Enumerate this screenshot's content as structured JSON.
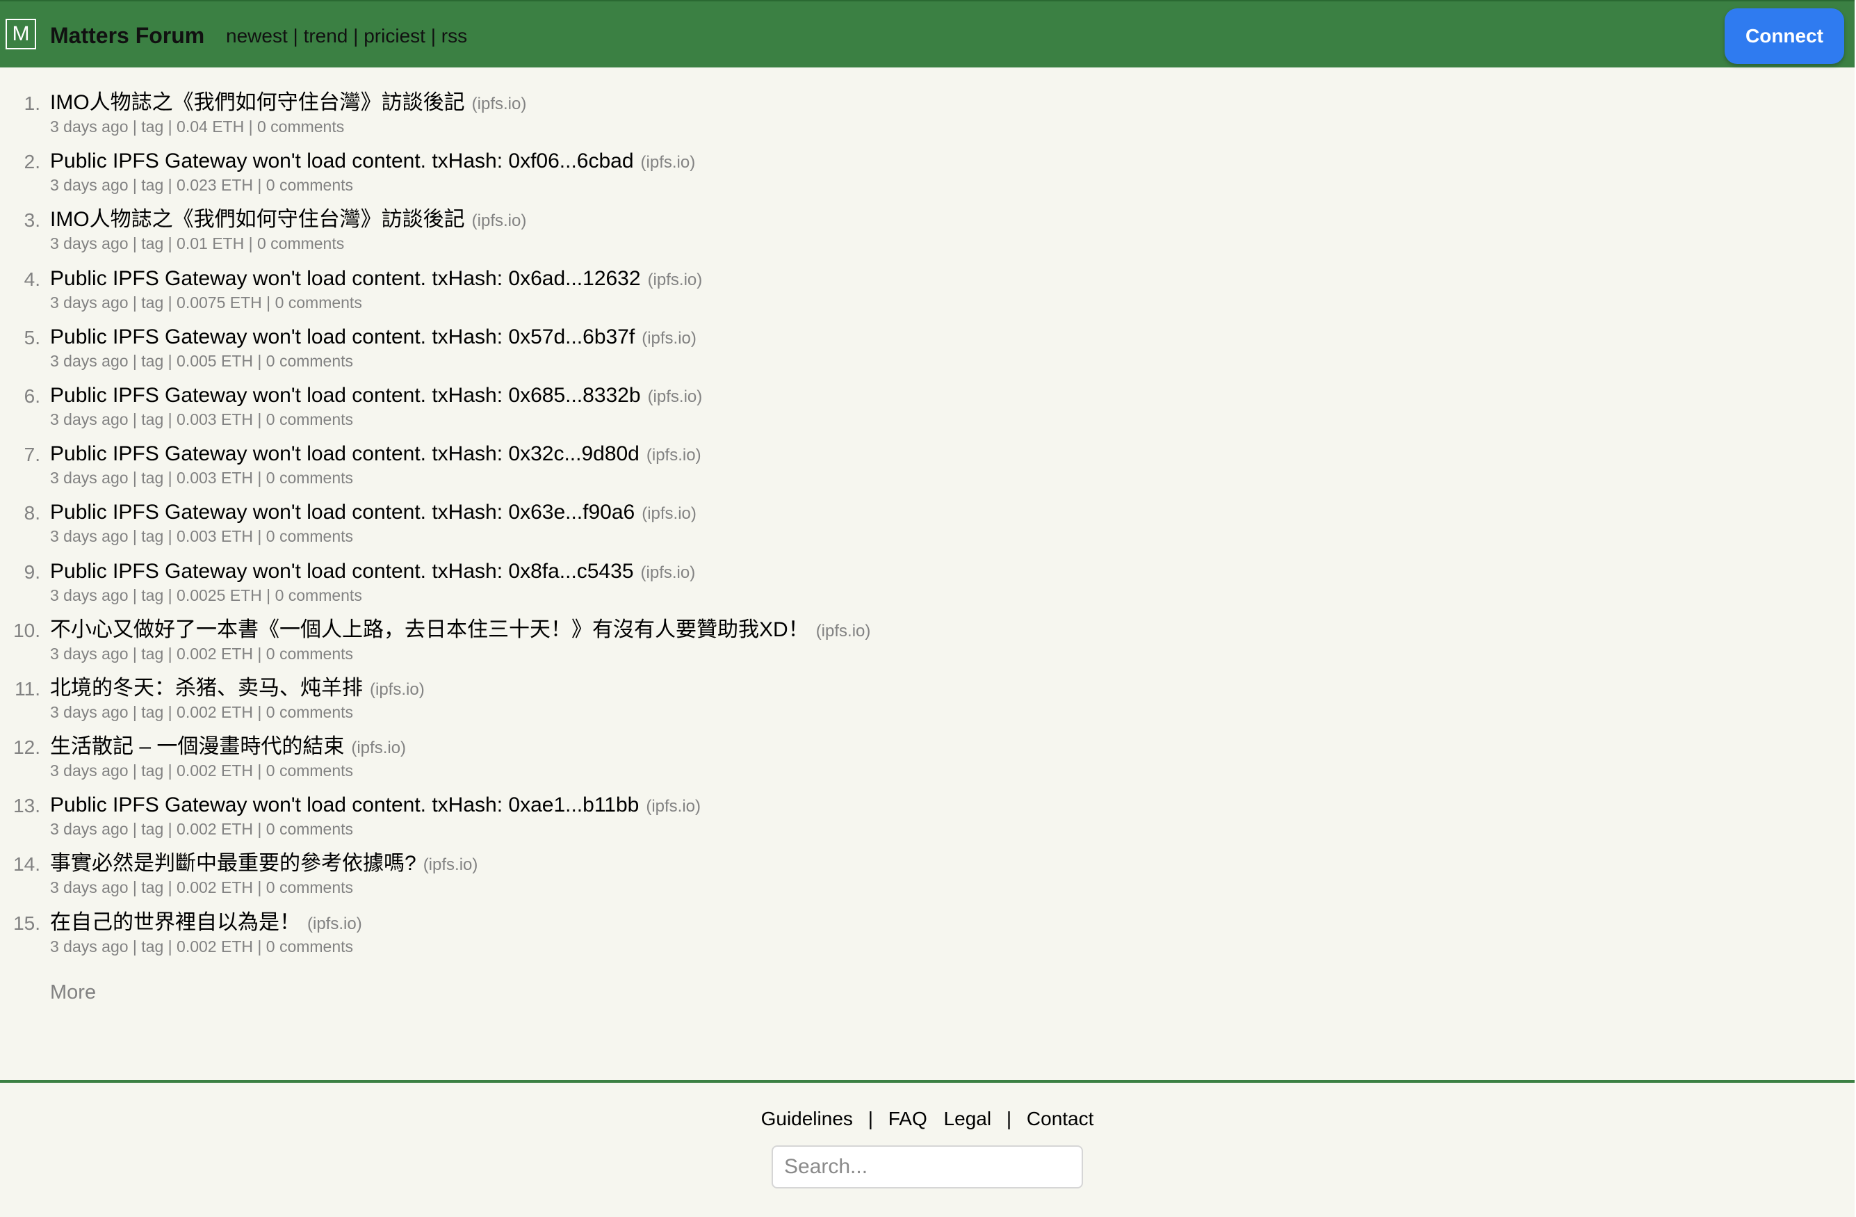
{
  "header": {
    "logo_letter": "M",
    "site_title": "Matters Forum",
    "nav": [
      "newest",
      "trend",
      "priciest",
      "rss"
    ],
    "connect_label": "Connect",
    "accent_color": "#3b8043",
    "button_color": "#2f7bf0"
  },
  "items": [
    {
      "rank": "1.",
      "title": "IMO人物誌之《我們如何守住台灣》訪談後記",
      "site": "(ipfs.io)",
      "age": "3 days ago",
      "tag": "tag",
      "price": "0.04 ETH",
      "comments": "0 comments"
    },
    {
      "rank": "2.",
      "title": "Public IPFS Gateway won't load content. txHash: 0xf06...6cbad",
      "site": "(ipfs.io)",
      "age": "3 days ago",
      "tag": "tag",
      "price": "0.023 ETH",
      "comments": "0 comments"
    },
    {
      "rank": "3.",
      "title": "IMO人物誌之《我們如何守住台灣》訪談後記",
      "site": "(ipfs.io)",
      "age": "3 days ago",
      "tag": "tag",
      "price": "0.01 ETH",
      "comments": "0 comments"
    },
    {
      "rank": "4.",
      "title": "Public IPFS Gateway won't load content. txHash: 0x6ad...12632",
      "site": "(ipfs.io)",
      "age": "3 days ago",
      "tag": "tag",
      "price": "0.0075 ETH",
      "comments": "0 comments"
    },
    {
      "rank": "5.",
      "title": "Public IPFS Gateway won't load content. txHash: 0x57d...6b37f",
      "site": "(ipfs.io)",
      "age": "3 days ago",
      "tag": "tag",
      "price": "0.005 ETH",
      "comments": "0 comments"
    },
    {
      "rank": "6.",
      "title": "Public IPFS Gateway won't load content. txHash: 0x685...8332b",
      "site": "(ipfs.io)",
      "age": "3 days ago",
      "tag": "tag",
      "price": "0.003 ETH",
      "comments": "0 comments"
    },
    {
      "rank": "7.",
      "title": "Public IPFS Gateway won't load content. txHash: 0x32c...9d80d",
      "site": "(ipfs.io)",
      "age": "3 days ago",
      "tag": "tag",
      "price": "0.003 ETH",
      "comments": "0 comments"
    },
    {
      "rank": "8.",
      "title": "Public IPFS Gateway won't load content. txHash: 0x63e...f90a6",
      "site": "(ipfs.io)",
      "age": "3 days ago",
      "tag": "tag",
      "price": "0.003 ETH",
      "comments": "0 comments"
    },
    {
      "rank": "9.",
      "title": "Public IPFS Gateway won't load content. txHash: 0x8fa...c5435",
      "site": "(ipfs.io)",
      "age": "3 days ago",
      "tag": "tag",
      "price": "0.0025 ETH",
      "comments": "0 comments"
    },
    {
      "rank": "10.",
      "title": "不小心又做好了一本書《一個人上路，去日本住三十天！》有沒有人要贊助我XD！",
      "site": "(ipfs.io)",
      "age": "3 days ago",
      "tag": "tag",
      "price": "0.002 ETH",
      "comments": "0 comments"
    },
    {
      "rank": "11.",
      "title": "北境的冬天：杀猪、卖马、炖羊排",
      "site": "(ipfs.io)",
      "age": "3 days ago",
      "tag": "tag",
      "price": "0.002 ETH",
      "comments": "0 comments"
    },
    {
      "rank": "12.",
      "title": "生活散記 – 一個漫畫時代的結束",
      "site": "(ipfs.io)",
      "age": "3 days ago",
      "tag": "tag",
      "price": "0.002 ETH",
      "comments": "0 comments"
    },
    {
      "rank": "13.",
      "title": "Public IPFS Gateway won't load content. txHash: 0xae1...b11bb",
      "site": "(ipfs.io)",
      "age": "3 days ago",
      "tag": "tag",
      "price": "0.002 ETH",
      "comments": "0 comments"
    },
    {
      "rank": "14.",
      "title": "事實必然是判斷中最重要的參考依據嗎?",
      "site": "(ipfs.io)",
      "age": "3 days ago",
      "tag": "tag",
      "price": "0.002 ETH",
      "comments": "0 comments"
    },
    {
      "rank": "15.",
      "title": "在自己的世界裡自以為是！",
      "site": "(ipfs.io)",
      "age": "3 days ago",
      "tag": "tag",
      "price": "0.002 ETH",
      "comments": "0 comments"
    }
  ],
  "more_label": "More",
  "footer": {
    "links": [
      "Guidelines",
      "FAQ",
      "Legal",
      "Contact"
    ],
    "search_placeholder": "Search..."
  }
}
